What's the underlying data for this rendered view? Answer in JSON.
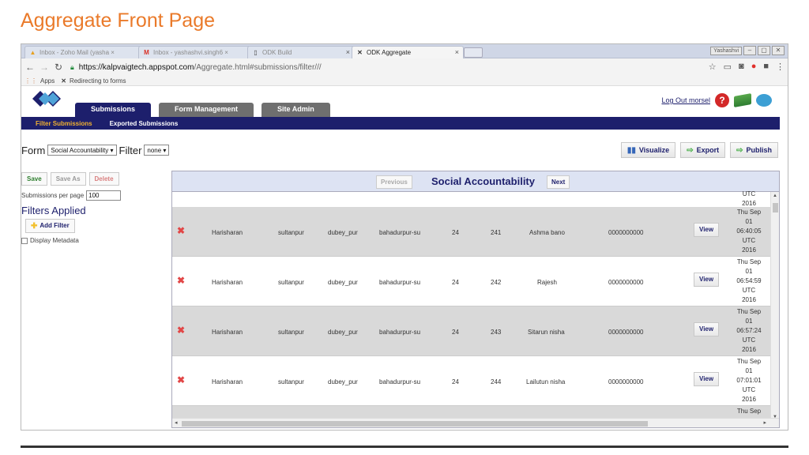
{
  "slide": {
    "title": "Aggregate Front Page"
  },
  "browser": {
    "tabs": [
      {
        "label": "Inbox - Zoho Mail (yasha ×",
        "icon": "zoho-mail-icon"
      },
      {
        "label": "Inbox - yashashvi.singh6 ×",
        "icon": "gmail-icon"
      },
      {
        "label": "ODK Build",
        "icon": "document-icon"
      },
      {
        "label": "ODK Aggregate",
        "icon": "odk-icon"
      }
    ],
    "window_user": "Yashashvi",
    "url_host": "https://kalpvaigtech.appspot.com",
    "url_path": "/Aggregate.html#submissions/filter///",
    "bookmarks": {
      "apps": "Apps",
      "redirect": "Redirecting to forms"
    }
  },
  "app": {
    "main_tabs": [
      "Submissions",
      "Form Management",
      "Site Admin"
    ],
    "logout": "Log Out morsel",
    "sub_tabs": [
      "Filter Submissions",
      "Exported Submissions"
    ],
    "form_label": "Form",
    "form_value": "Social Accountability ▾",
    "filter_label": "Filter",
    "filter_value": "none ▾",
    "actions": {
      "visualize": "Visualize",
      "export": "Export",
      "publish": "Publish"
    },
    "left": {
      "save": "Save",
      "save_as": "Save As",
      "delete": "Delete",
      "per_page_label": "Submissions per page",
      "per_page_value": "100",
      "filters_applied": "Filters Applied",
      "add_filter": "Add Filter",
      "display_metadata": "Display Metadata"
    },
    "grid": {
      "previous": "Previous",
      "title": "Social Accountability",
      "next": "Next",
      "top_partial": [
        "UTC",
        "2016"
      ],
      "rows": [
        {
          "c1": "Harisharan",
          "c2": "sultanpur",
          "c3": "dubey_pur",
          "c4": "bahadurpur-su",
          "c5": "24",
          "c6": "241",
          "c7": "Ashma bano",
          "c8": "0000000000",
          "view": "View",
          "date": [
            "Thu Sep",
            "01",
            "06:40:05",
            "UTC",
            "2016"
          ]
        },
        {
          "c1": "Harisharan",
          "c2": "sultanpur",
          "c3": "dubey_pur",
          "c4": "bahadurpur-su",
          "c5": "24",
          "c6": "242",
          "c7": "Rajesh",
          "c8": "0000000000",
          "view": "View",
          "date": [
            "Thu Sep",
            "01",
            "06:54:59",
            "UTC",
            "2016"
          ]
        },
        {
          "c1": "Harisharan",
          "c2": "sultanpur",
          "c3": "dubey_pur",
          "c4": "bahadurpur-su",
          "c5": "24",
          "c6": "243",
          "c7": "Sitarun nisha",
          "c8": "0000000000",
          "view": "View",
          "date": [
            "Thu Sep",
            "01",
            "06:57:24",
            "UTC",
            "2016"
          ]
        },
        {
          "c1": "Harisharan",
          "c2": "sultanpur",
          "c3": "dubey_pur",
          "c4": "bahadurpur-su",
          "c5": "24",
          "c6": "244",
          "c7": "Lailutun nisha",
          "c8": "0000000000",
          "view": "View",
          "date": [
            "Thu Sep",
            "01",
            "07:01:01",
            "UTC",
            "2016"
          ]
        }
      ],
      "bottom_partial": "Thu Sep"
    }
  },
  "colors": {
    "accent": "#ea7a2a",
    "navy": "#1d1f6c",
    "row_grey": "#d9d9d9"
  }
}
